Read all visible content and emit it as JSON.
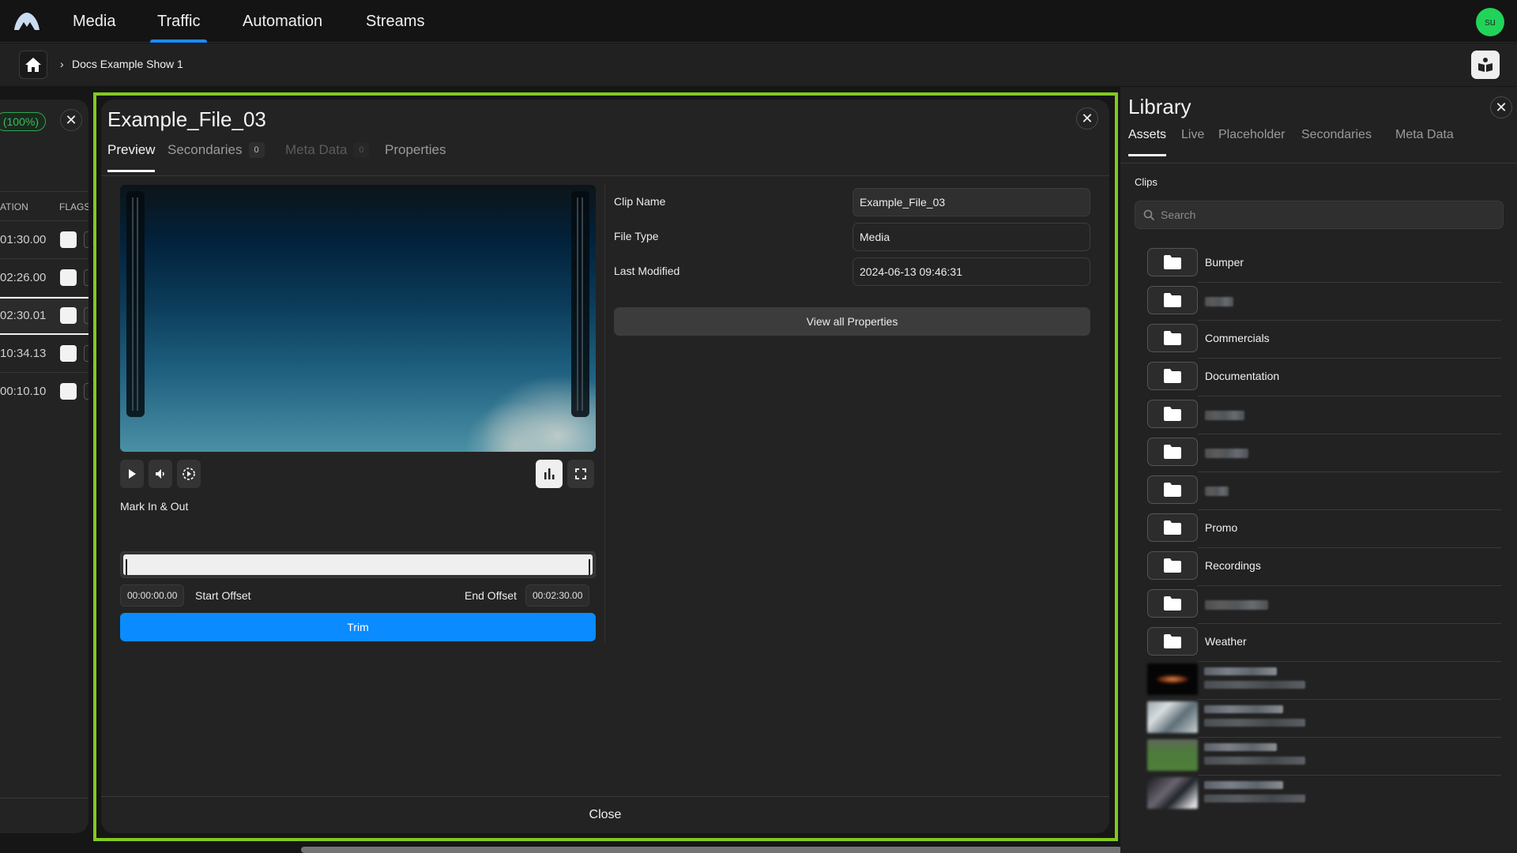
{
  "accent": "#1a8cff",
  "highlight_color": "#82c91e",
  "nav": {
    "items": [
      {
        "label": "Media",
        "active": false
      },
      {
        "label": "Traffic",
        "active": true
      },
      {
        "label": "Automation",
        "active": false
      },
      {
        "label": "Streams",
        "active": false
      }
    ],
    "avatar_initials": "su"
  },
  "breadcrumb": {
    "items": [
      "Docs Example Show 1"
    ]
  },
  "left_panel": {
    "progress_badge": "(100%)",
    "columns": [
      "ATION",
      "FLAGS"
    ],
    "rows": [
      {
        "duration": "01:30.00",
        "selected": false
      },
      {
        "duration": "02:26.00",
        "selected": false
      },
      {
        "duration": "02:30.01",
        "selected": true
      },
      {
        "duration": "10:34.13",
        "selected": false
      },
      {
        "duration": "00:10.10",
        "selected": false
      }
    ]
  },
  "modal": {
    "title": "Example_File_03",
    "tabs": [
      {
        "label": "Preview",
        "active": true,
        "count": null
      },
      {
        "label": "Secondaries",
        "active": false,
        "count": "0"
      },
      {
        "label": "Meta Data",
        "active": false,
        "disabled": true,
        "count": "0"
      },
      {
        "label": "Properties",
        "active": false,
        "count": null
      }
    ],
    "preview": {
      "mark_label": "Mark In & Out",
      "start_offset_value": "00:00:00.00",
      "start_offset_label": "Start Offset",
      "end_offset_label": "End Offset",
      "end_offset_value": "00:02:30.00",
      "trim_label": "Trim"
    },
    "properties": {
      "fields": [
        {
          "label": "Clip Name",
          "value": "Example_File_03"
        },
        {
          "label": "File Type",
          "value": "Media"
        },
        {
          "label": "Last Modified",
          "value": "2024-06-13 09:46:31"
        }
      ],
      "view_all_label": "View all Properties"
    },
    "footer_close_label": "Close"
  },
  "library": {
    "title": "Library",
    "tabs": [
      {
        "label": "Assets",
        "active": true
      },
      {
        "label": "Live",
        "active": false
      },
      {
        "label": "Placeholder",
        "active": false
      },
      {
        "label": "Secondaries",
        "active": false
      },
      {
        "label": "Meta Data",
        "active": false
      }
    ],
    "section_label": "Clips",
    "search_placeholder": "Search",
    "folders": [
      {
        "label": "Bumper",
        "redacted": false
      },
      {
        "label": "",
        "redacted": true
      },
      {
        "label": "Commercials",
        "redacted": false
      },
      {
        "label": "Documentation",
        "redacted": false
      },
      {
        "label": "",
        "redacted": true
      },
      {
        "label": "",
        "redacted": true
      },
      {
        "label": "",
        "redacted": true
      },
      {
        "label": "Promo",
        "redacted": false
      },
      {
        "label": "Recordings",
        "redacted": false
      },
      {
        "label": "",
        "redacted": true
      },
      {
        "label": "Weather",
        "redacted": false
      }
    ],
    "clips_redacted_count": 4
  }
}
